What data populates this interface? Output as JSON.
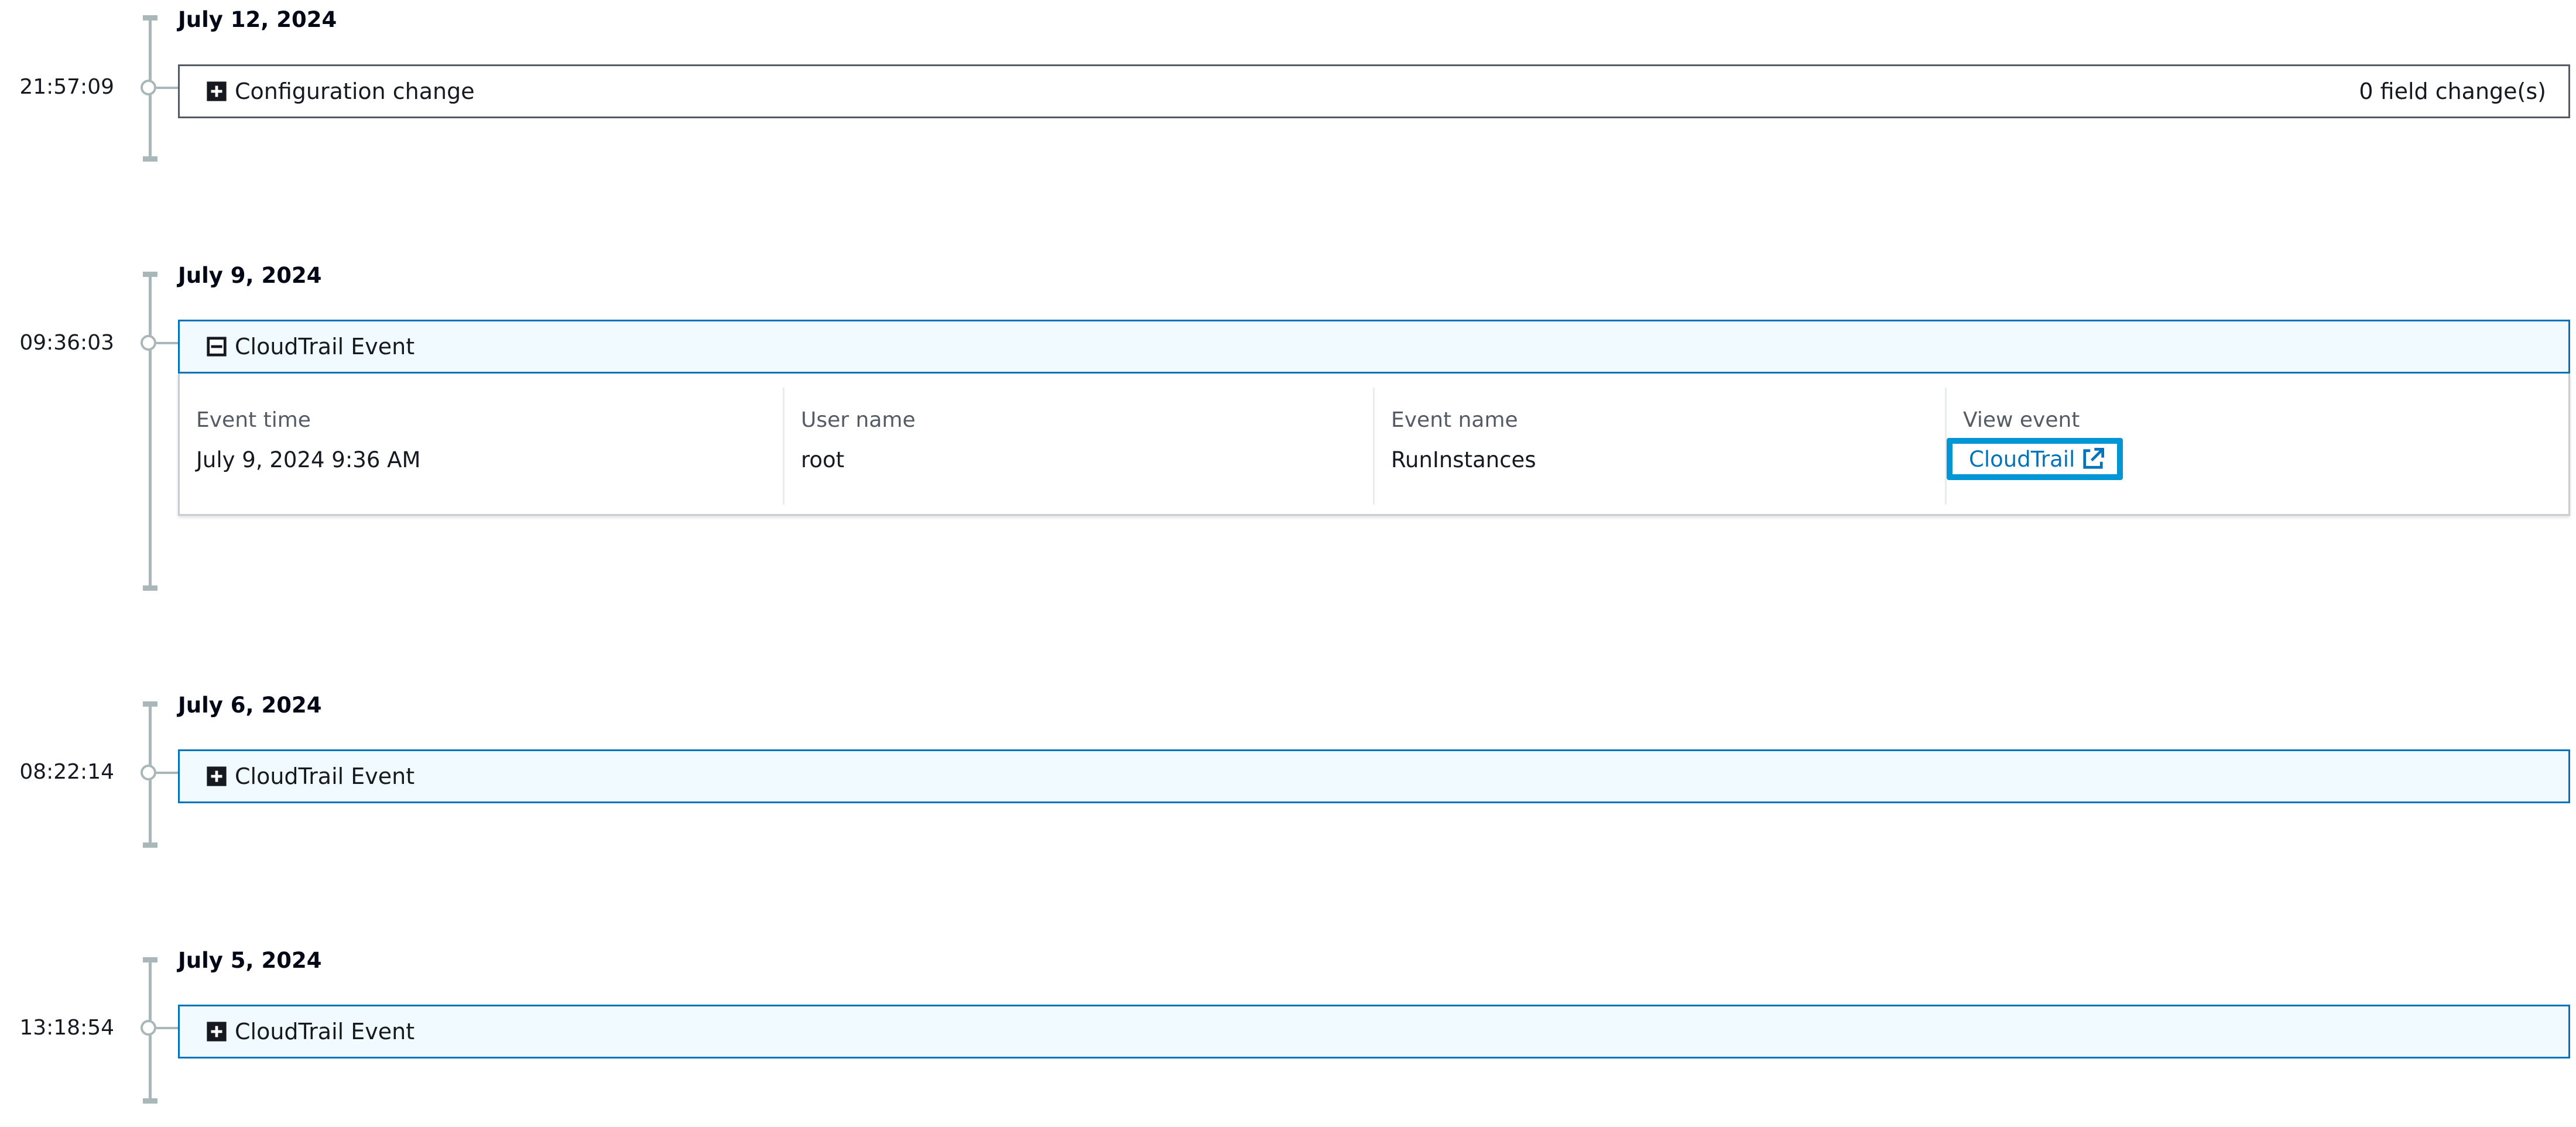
{
  "timeline": [
    {
      "date": "July 12, 2024",
      "time": "21:57:09",
      "event_type": "Configuration change",
      "expanded": false,
      "right_text": "0 field change(s)",
      "toggle_icon": "expand-icon"
    },
    {
      "date": "July 9, 2024",
      "time": "09:36:03",
      "event_type": "CloudTrail Event",
      "expanded": true,
      "toggle_icon": "collapse-icon",
      "details": {
        "event_time_label": "Event time",
        "event_time_value": "July 9, 2024 9:36 AM",
        "user_name_label": "User name",
        "user_name_value": "root",
        "event_name_label": "Event name",
        "event_name_value": "RunInstances",
        "view_event_label": "View event",
        "view_event_link": "CloudTrail",
        "link_icon": "external-link-icon"
      }
    },
    {
      "date": "July 6, 2024",
      "time": "08:22:14",
      "event_type": "CloudTrail Event",
      "expanded": false,
      "toggle_icon": "expand-icon"
    },
    {
      "date": "July 5, 2024",
      "time": "13:18:54",
      "event_type": "CloudTrail Event",
      "expanded": false,
      "toggle_icon": "expand-icon"
    }
  ],
  "colors": {
    "accent": "#0073bb",
    "focus_ring": "#0096d6",
    "header_bg": "#f1faff",
    "timeline": "#aab7b8"
  }
}
